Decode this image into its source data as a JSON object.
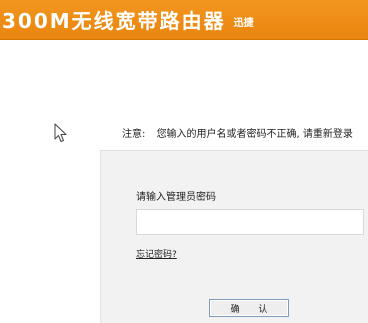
{
  "header": {
    "title": "300M无线宽带路由器",
    "brand": "迅捷"
  },
  "notice": {
    "label": "注意:",
    "message": "您输入的用户名或者密码不正确, 请重新登录"
  },
  "login": {
    "prompt": "请输入管理员密码",
    "password_value": "",
    "forgot_link": "忘记密码?",
    "confirm_label": "确 认"
  },
  "colors": {
    "header_bg": "#ef8f17",
    "panel_bg": "#f2f2f2"
  }
}
